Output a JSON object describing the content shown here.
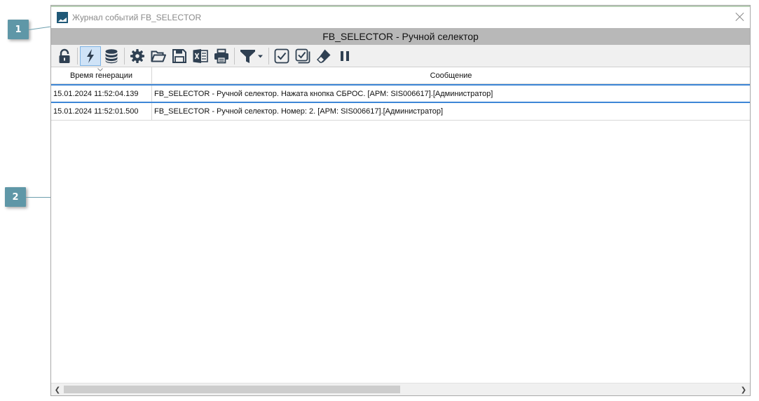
{
  "window": {
    "title": "Журнал событий FB_SELECTOR",
    "header": "FB_SELECTOR - Ручной селектор"
  },
  "callouts": [
    "1",
    "2"
  ],
  "toolbar": {
    "buttons": [
      {
        "name": "lock",
        "icon": "lock-icon"
      },
      {
        "name": "lightning",
        "icon": "lightning-icon",
        "active": true
      },
      {
        "name": "database",
        "icon": "database-icon"
      },
      {
        "name": "settings",
        "icon": "gear-icon"
      },
      {
        "name": "open",
        "icon": "folder-open-icon"
      },
      {
        "name": "save",
        "icon": "floppy-icon"
      },
      {
        "name": "excel",
        "icon": "excel-icon"
      },
      {
        "name": "print",
        "icon": "printer-icon"
      },
      {
        "name": "filter",
        "icon": "filter-dropdown-icon"
      },
      {
        "name": "acknowledge",
        "icon": "checkbox-icon"
      },
      {
        "name": "acknowledge-all",
        "icon": "checkbox-multiple-icon"
      },
      {
        "name": "eraser",
        "icon": "eraser-icon"
      },
      {
        "name": "pause",
        "icon": "pause-icon"
      }
    ]
  },
  "table": {
    "columns": [
      "Время генерации",
      "Сообщение"
    ],
    "rows": [
      {
        "time": "15.01.2024 11:52:04.139",
        "message": "FB_SELECTOR - Ручной селектор. Нажата кнопка СБРОС. [АРМ: SIS006617].[Администратор]",
        "selected": true
      },
      {
        "time": "15.01.2024 11:52:01.500",
        "message": "FB_SELECTOR - Ручной селектор. Номер: 2. [АРМ: SIS006617].[Администратор]",
        "selected": false
      }
    ]
  },
  "colors": {
    "accent": "#3d86d6",
    "callout": "#5f97a7",
    "icon": "#2f4052",
    "header_bar": "#b8b8b8"
  }
}
